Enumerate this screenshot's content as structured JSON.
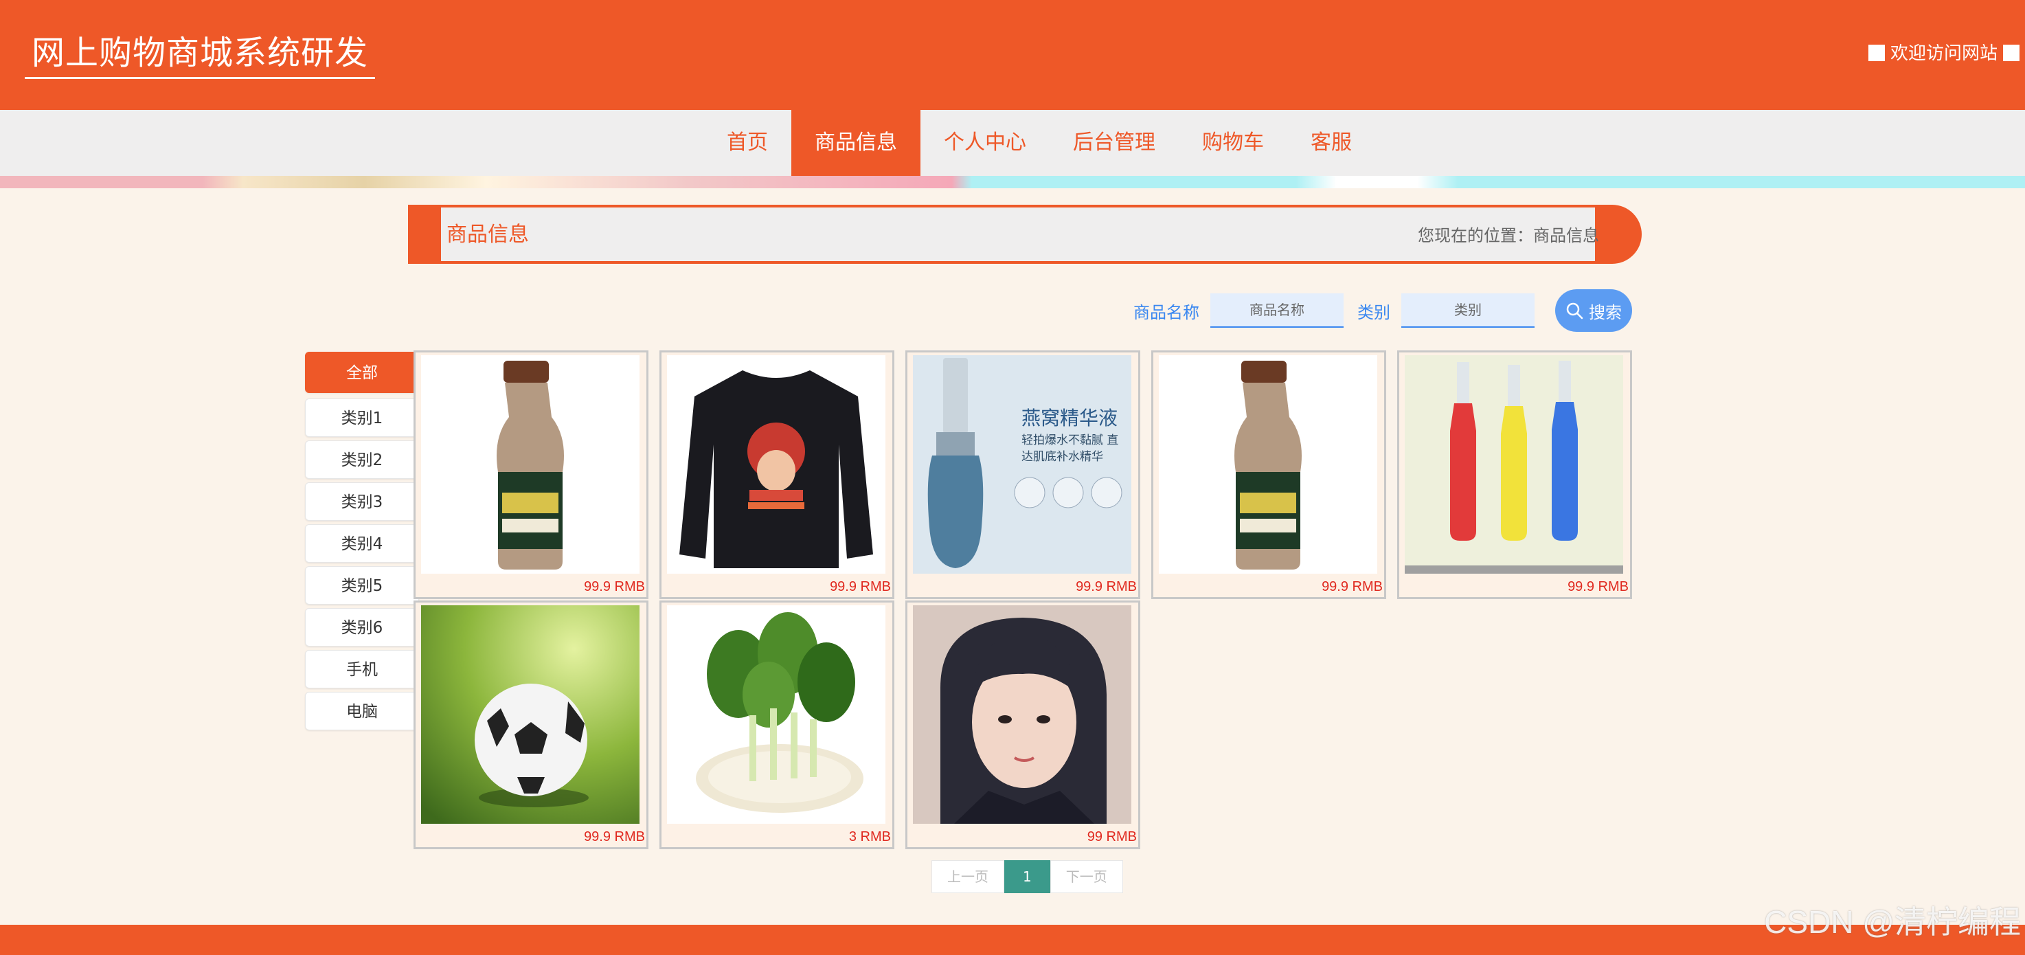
{
  "header": {
    "site_title": "网上购物商城系统研发",
    "welcome_text": "欢迎访问网站"
  },
  "nav": {
    "items": [
      {
        "label": "首页"
      },
      {
        "label": "商品信息"
      },
      {
        "label": "个人中心"
      },
      {
        "label": "后台管理"
      },
      {
        "label": "购物车"
      },
      {
        "label": "客服"
      }
    ],
    "active": "商品信息"
  },
  "breadcrumb": {
    "title": "商品信息",
    "location_label": "您现在的位置：",
    "location_value": "商品信息"
  },
  "search": {
    "name_label": "商品名称",
    "name_placeholder": "商品名称",
    "category_label": "类别",
    "category_placeholder": "类别",
    "button_label": "搜索"
  },
  "categories": [
    "全部",
    "类别1",
    "类别2",
    "类别3",
    "类别4",
    "类别5",
    "类别6",
    "手机",
    "电脑"
  ],
  "active_category": "全部",
  "products": [
    {
      "price": "99.9 RMB",
      "image": "milk-tea-bottle"
    },
    {
      "price": "99.9 RMB",
      "image": "black-tshirt"
    },
    {
      "price": "99.9 RMB",
      "image": "serum-bottle",
      "image_text": "燕窝精华液",
      "image_subtext": "轻拍爆水不黏腻 直达肌底补水精华"
    },
    {
      "price": "99.9 RMB",
      "image": "milk-tea-bottle"
    },
    {
      "price": "99.9 RMB",
      "image": "three-color-bottles"
    },
    {
      "price": "99.9 RMB",
      "image": "soccer-ball"
    },
    {
      "price": "3 RMB",
      "image": "green-vegetables"
    },
    {
      "price": "99 RMB",
      "image": "girl-portrait"
    }
  ],
  "pagination": {
    "prev_label": "上一页",
    "current": "1",
    "next_label": "下一页"
  },
  "watermark": "CSDN @清柠编程",
  "colors": {
    "brand": "#ee5828",
    "page_bg": "#fbf3ea",
    "nav_bg": "#efeeee",
    "link_blue": "#3a87f0",
    "price_red": "#e02a20",
    "pager_active": "#3b9a8b"
  }
}
